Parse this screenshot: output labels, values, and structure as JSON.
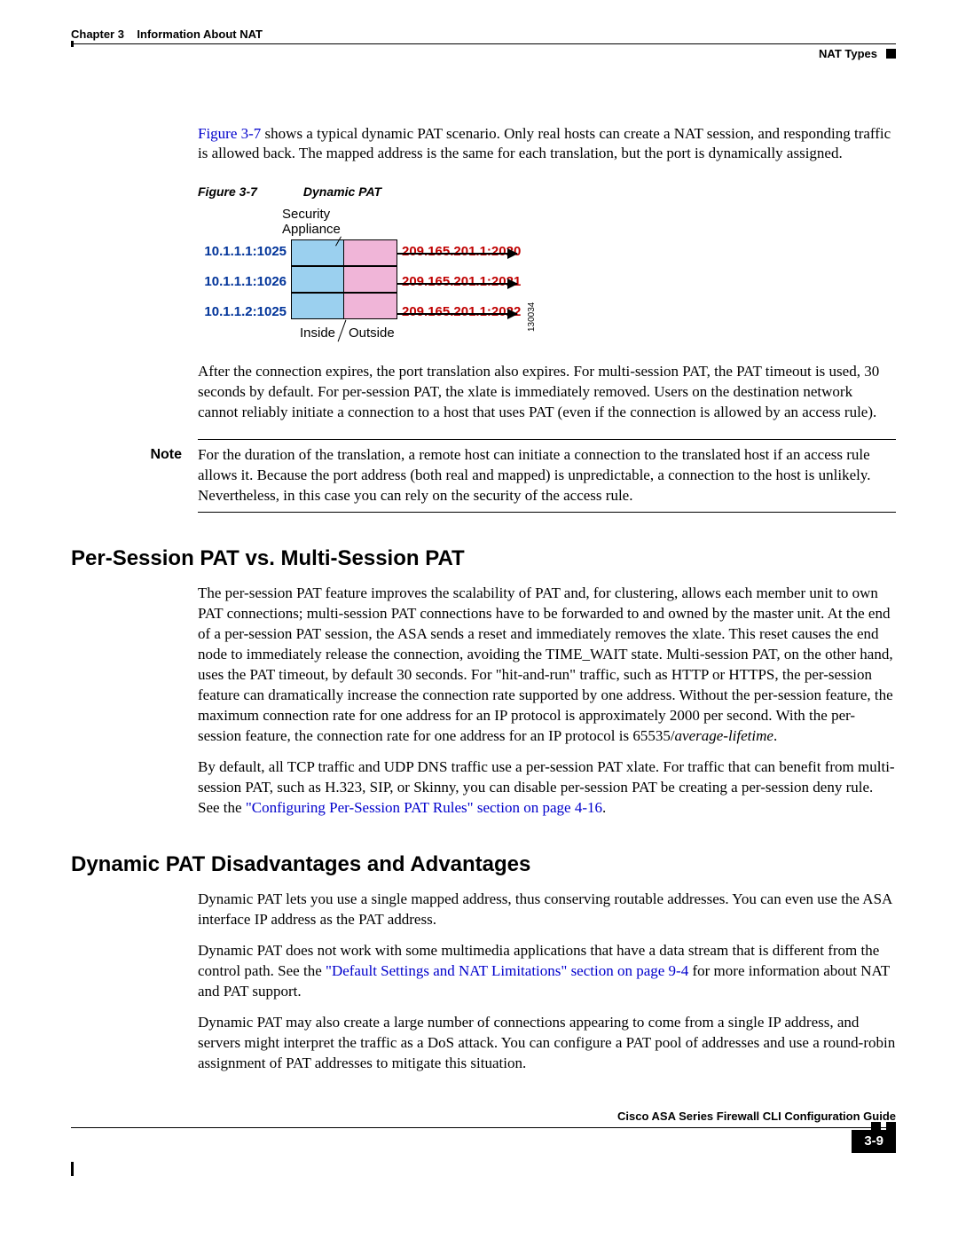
{
  "header": {
    "chapter_label": "Chapter 3",
    "chapter_title": "Information About NAT",
    "section_right": "NAT Types"
  },
  "intro": {
    "link_text": "Figure 3-7",
    "para_text": " shows a typical dynamic PAT scenario. Only real hosts can create a NAT session, and responding traffic is allowed back. The mapped address is the same for each translation, but the port is dynamically assigned."
  },
  "figure": {
    "caption_num": "Figure 3-7",
    "caption_title": "Dynamic PAT",
    "appliance_line1": "Security",
    "appliance_line2": "Appliance",
    "rows": [
      {
        "left": "10.1.1.1:1025",
        "right": "209.165.201.1:2020"
      },
      {
        "left": "10.1.1.1:1026",
        "right": "209.165.201.1:2021"
      },
      {
        "left": "10.1.1.2:1025",
        "right": "209.165.201.1:2022"
      }
    ],
    "inside_label": "Inside",
    "outside_label": "Outside",
    "side_number": "130034"
  },
  "after_figure_para": "After the connection expires, the port translation also expires. For multi-session PAT, the PAT timeout is used, 30 seconds by default. For per-session PAT, the xlate is immediately removed. Users on the destination network cannot reliably initiate a connection to a host that uses PAT (even if the connection is allowed by an access rule).",
  "note": {
    "label": "Note",
    "body": "For the duration of the translation, a remote host can initiate a connection to the translated host if an access rule allows it. Because the port address (both real and mapped) is unpredictable, a connection to the host is unlikely. Nevertheless, in this case you can rely on the security of the access rule."
  },
  "section_per_session": {
    "heading": "Per-Session PAT vs. Multi-Session PAT",
    "para1_part1": "The per-session PAT feature improves the scalability of PAT and, for clustering, allows each member unit to own PAT connections; multi-session PAT connections have to be forwarded to and owned by the master unit. At the end of a per-session PAT session, the ASA sends a reset and immediately removes the xlate. This reset causes the end node to immediately release the connection, avoiding the TIME_WAIT state. Multi-session PAT, on the other hand, uses the PAT timeout, by default 30 seconds. For \"hit-and-run\" traffic, such as HTTP or HTTPS, the per-session feature can dramatically increase the connection rate supported by one address. Without the per-session feature, the maximum connection rate for one address for an IP protocol is approximately 2000 per second. With the per-session feature, the connection rate for one address for an IP protocol is 65535/",
    "para1_italic": "average-lifetime",
    "para1_part2": ".",
    "para2_part1": "By default, all TCP traffic and UDP DNS traffic use a per-session PAT xlate. For traffic that can benefit from multi-session PAT, such as H.323, SIP, or Skinny, you can disable per-session PAT be creating a per-session deny rule. See the ",
    "para2_link": "\"Configuring Per-Session PAT Rules\" section on page 4-16",
    "para2_part2": "."
  },
  "section_dyn_pat": {
    "heading": "Dynamic PAT Disadvantages and Advantages",
    "para1": "Dynamic PAT lets you use a single mapped address, thus conserving routable addresses. You can even use the ASA interface IP address as the PAT address.",
    "para2_part1": "Dynamic PAT does not work with some multimedia applications that have a data stream that is different from the control path. See the ",
    "para2_link": "\"Default Settings and NAT Limitations\" section on page 9-4",
    "para2_part2": " for more information about NAT and PAT support.",
    "para3": "Dynamic PAT may also create a large number of connections appearing to come from a single IP address, and servers might interpret the traffic as a DoS attack. You can configure a PAT pool of addresses and use a round-robin assignment of PAT addresses to mitigate this situation."
  },
  "footer": {
    "guide_title": "Cisco ASA Series Firewall CLI Configuration Guide",
    "page_number": "3-9"
  }
}
